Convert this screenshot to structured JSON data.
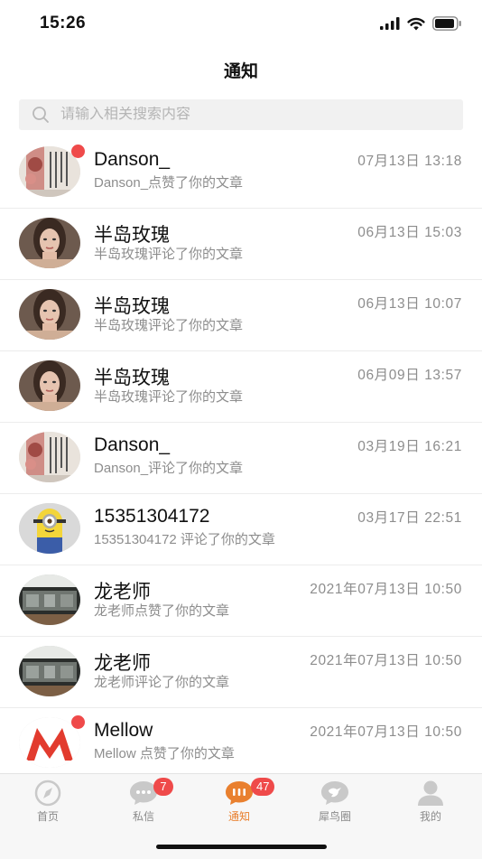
{
  "status_bar": {
    "time": "15:26",
    "icons": [
      "signal-icon",
      "wifi-icon",
      "battery-icon"
    ]
  },
  "header": {
    "title": "通知"
  },
  "search": {
    "placeholder": "请输入相关搜索内容",
    "value": "",
    "icon": "search-icon"
  },
  "notifications": [
    {
      "name": "Danson_",
      "desc": "Danson_点赞了你的文章",
      "time": "07月13日 13:18",
      "unread": true,
      "avatar": "painting"
    },
    {
      "name": "半岛玫瑰",
      "desc": "半岛玫瑰评论了你的文章",
      "time": "06月13日 15:03",
      "unread": false,
      "avatar": "girl"
    },
    {
      "name": "半岛玫瑰",
      "desc": "半岛玫瑰评论了你的文章",
      "time": "06月13日 10:07",
      "unread": false,
      "avatar": "girl"
    },
    {
      "name": "半岛玫瑰",
      "desc": "半岛玫瑰评论了你的文章",
      "time": "06月09日 13:57",
      "unread": false,
      "avatar": "girl"
    },
    {
      "name": "Danson_",
      "desc": "Danson_评论了你的文章",
      "time": "03月19日 16:21",
      "unread": false,
      "avatar": "painting"
    },
    {
      "name": "15351304172",
      "desc": "15351304172 评论了你的文章",
      "time": "03月17日 22:51",
      "unread": false,
      "avatar": "minion"
    },
    {
      "name": "龙老师",
      "desc": "龙老师点赞了你的文章",
      "time": "2021年07月13日 10:50",
      "unread": false,
      "avatar": "landscape"
    },
    {
      "name": "龙老师",
      "desc": "龙老师评论了你的文章",
      "time": "2021年07月13日 10:50",
      "unread": false,
      "avatar": "landscape"
    },
    {
      "name": "Mellow",
      "desc": "Mellow 点赞了你的文章",
      "time": "2021年07月13日 10:50",
      "unread": true,
      "avatar": "m-logo"
    }
  ],
  "tabbar": {
    "tabs": [
      {
        "label": "首页",
        "icon": "compass-icon",
        "badge": "",
        "active": false
      },
      {
        "label": "私信",
        "icon": "chat-icon",
        "badge": "7",
        "active": false
      },
      {
        "label": "通知",
        "icon": "notification-chat-icon",
        "badge": "47",
        "active": true
      },
      {
        "label": "犀鸟圈",
        "icon": "bird-icon",
        "badge": "",
        "active": false
      },
      {
        "label": "我的",
        "icon": "profile-icon",
        "badge": "",
        "active": false
      }
    ]
  },
  "colors": {
    "accent": "#e9802f",
    "badge": "#ef4a4a",
    "muted_text": "#8d8d8d"
  }
}
